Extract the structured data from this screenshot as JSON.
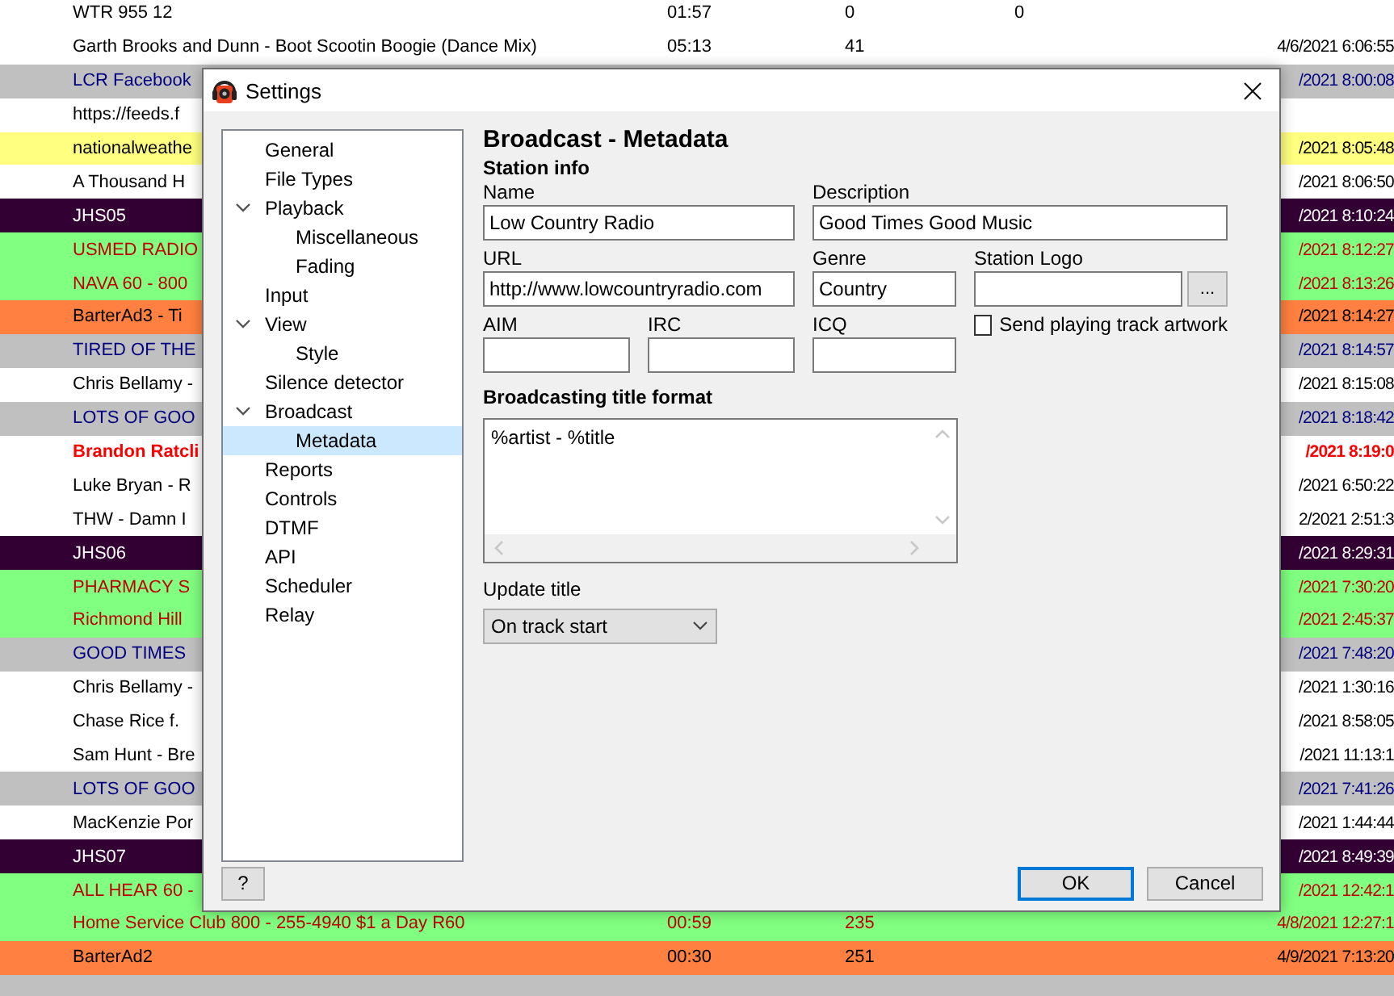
{
  "playlist": {
    "rows": [
      {
        "kind": "plain",
        "title": "WTR 955 12",
        "duration": "01:57",
        "column_3": "0",
        "column_4": "0"
      },
      {
        "kind": "plain",
        "title": "Garth Brooks and Dunn - Boot Scootin Boogie (Dance Mix)",
        "duration": "05:13",
        "column_3": "41",
        "date": "4/6/2021 6:06:55"
      },
      {
        "kind": "promo",
        "title": "LCR Facebook",
        "date": "/2021 8:00:08"
      },
      {
        "kind": "plain",
        "title": "https://feeds.f"
      },
      {
        "kind": "weather",
        "title": "nationalweathe",
        "date": "/2021 8:05:48"
      },
      {
        "kind": "plain",
        "title": "A Thousand H",
        "date": "/2021 8:06:50"
      },
      {
        "kind": "id",
        "title": "JHS05",
        "date": "/2021 8:10:24"
      },
      {
        "kind": "spot",
        "title": "USMED RADIO",
        "date": "/2021 8:12:27"
      },
      {
        "kind": "spot",
        "title": "NAVA 60 - 800",
        "date": "/2021 8:13:26"
      },
      {
        "kind": "barter",
        "title": "BarterAd3 - Ti",
        "date": "/2021 8:14:27"
      },
      {
        "kind": "promo",
        "title": "TIRED OF THE",
        "date": "/2021 8:14:57"
      },
      {
        "kind": "plain",
        "title": "Chris Bellamy -",
        "date": "/2021 8:15:08"
      },
      {
        "kind": "promo",
        "title": "LOTS OF GOO",
        "date": "/2021 8:18:42"
      },
      {
        "kind": "playing",
        "title": "Brandon Ratcli",
        "date": "/2021 8:19:0"
      },
      {
        "kind": "plain",
        "title": "Luke Bryan - R",
        "date": "/2021 6:50:22"
      },
      {
        "kind": "plain",
        "title": "THW - Damn I",
        "date": "2/2021 2:51:3"
      },
      {
        "kind": "id",
        "title": "JHS06",
        "date": "/2021 8:29:31"
      },
      {
        "kind": "spot",
        "title": "PHARMACY S",
        "date": "/2021 7:30:20"
      },
      {
        "kind": "spot",
        "title": "Richmond Hill",
        "date": "/2021 2:45:37"
      },
      {
        "kind": "promo",
        "title": "GOOD TIMES",
        "date": "/2021 7:48:20"
      },
      {
        "kind": "plain",
        "title": "Chris Bellamy -",
        "date": "/2021 1:30:16"
      },
      {
        "kind": "plain",
        "title": "Chase Rice f.",
        "date": "/2021 8:58:05"
      },
      {
        "kind": "plain",
        "title": "Sam Hunt - Bre",
        "date": "/2021 11:13:1"
      },
      {
        "kind": "promo",
        "title": "LOTS OF GOO",
        "date": "/2021 7:41:26"
      },
      {
        "kind": "plain",
        "title": "MacKenzie Por",
        "date": "/2021 1:44:44"
      },
      {
        "kind": "id",
        "title": "JHS07",
        "date": "/2021 8:49:39"
      },
      {
        "kind": "spot",
        "title": "ALL HEAR 60 -",
        "date": "/2021 12:42:1"
      },
      {
        "kind": "spot",
        "title": "Home Service Club 800 - 255-4940 $1 a Day R60",
        "duration": "00:59",
        "column_3": "235",
        "date": "4/8/2021 12:27:1"
      },
      {
        "kind": "barter",
        "title": "BarterAd2",
        "duration": "00:30",
        "column_3": "251",
        "date": "4/9/2021 7:13:20"
      },
      {
        "kind": "promo"
      }
    ]
  },
  "dialog": {
    "title": "Settings",
    "tree": [
      {
        "label": "General",
        "selected": false
      },
      {
        "label": "File Types",
        "selected": false
      },
      {
        "label": "Playback",
        "selected": false,
        "expanded": true,
        "children": [
          {
            "label": "Miscellaneous",
            "selected": false
          },
          {
            "label": "Fading",
            "selected": false
          }
        ]
      },
      {
        "label": "Input",
        "selected": false
      },
      {
        "label": "View",
        "selected": false,
        "expanded": true,
        "children": [
          {
            "label": "Style",
            "selected": false
          }
        ]
      },
      {
        "label": "Silence detector",
        "selected": false
      },
      {
        "label": "Broadcast",
        "selected": false,
        "expanded": true,
        "children": [
          {
            "label": "Metadata",
            "selected": true
          }
        ]
      },
      {
        "label": "Reports",
        "selected": false
      },
      {
        "label": "Controls",
        "selected": false
      },
      {
        "label": "DTMF",
        "selected": false
      },
      {
        "label": "API",
        "selected": false
      },
      {
        "label": "Scheduler",
        "selected": false
      },
      {
        "label": "Relay",
        "selected": false
      }
    ],
    "heading": "Broadcast - Metadata",
    "section": "Station info",
    "name": {
      "label": "Name",
      "value": "Low Country Radio"
    },
    "description": {
      "label": "Description",
      "value": "Good Times Good Music"
    },
    "url": {
      "label": "URL",
      "value": "http://www.lowcountryradio.com"
    },
    "genre": {
      "label": "Genre",
      "value": "Country"
    },
    "station_logo": {
      "label": "Station Logo",
      "browse": "..."
    },
    "aim": {
      "label": "AIM"
    },
    "irc": {
      "label": "IRC"
    },
    "icq": {
      "label": "ICQ"
    },
    "artwork": {
      "label": "Send playing track artwork",
      "checked": false
    },
    "title_format": {
      "label": "Broadcasting title format",
      "value": "%artist - %title"
    },
    "update_title": {
      "label": "Update title",
      "value": "On track start"
    },
    "help": "?",
    "buttons": [
      {
        "label": "OK",
        "default": true
      },
      {
        "label": "Cancel",
        "default": false
      }
    ]
  }
}
